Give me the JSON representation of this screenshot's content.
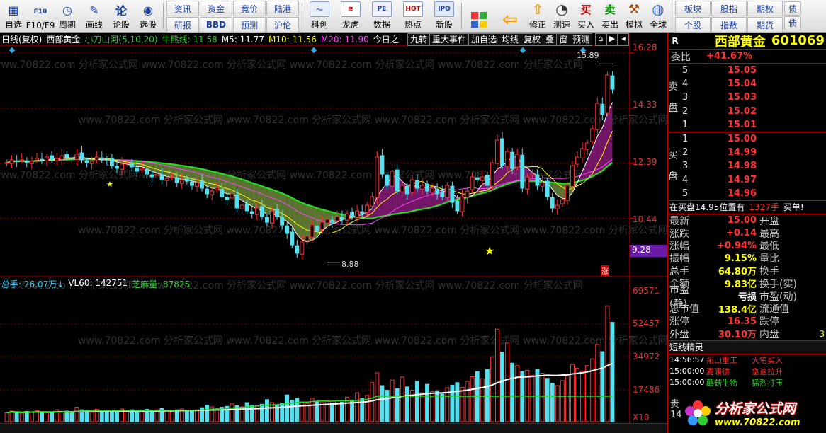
{
  "toolbar": {
    "left_buttons": [
      {
        "label": "自选",
        "icon": "grid-icon"
      },
      {
        "label": "F10/F9",
        "icon": "f10-icon"
      },
      {
        "label": "周期",
        "icon": "clock-icon"
      },
      {
        "label": "画线",
        "icon": "pencil-icon"
      },
      {
        "label": "论股",
        "icon": "discuss-icon"
      },
      {
        "label": "选股",
        "icon": "chart-pick-icon"
      }
    ],
    "grid1": [
      "资讯",
      "资金",
      "竞价",
      "陆港",
      "研报",
      "BBD",
      "预测",
      "沪伦"
    ],
    "icon_buttons": [
      {
        "label": "科创",
        "icon": "kechuang-icon"
      },
      {
        "label": "龙虎",
        "icon": "dragon-icon"
      },
      {
        "label": "数据",
        "icon": "pe-icon"
      },
      {
        "label": "热点",
        "icon": "hot-icon"
      },
      {
        "label": "新股",
        "icon": "ipo-icon"
      }
    ],
    "right_buttons": [
      {
        "label": "",
        "icon": "window-layout-icon"
      },
      {
        "label": "",
        "icon": "back-arrow-icon"
      },
      {
        "label": "修正",
        "icon": "correct-icon"
      },
      {
        "label": "测速",
        "icon": "speed-icon"
      },
      {
        "label": "买入",
        "icon": "buy-icon"
      },
      {
        "label": "卖出",
        "icon": "sell-icon"
      },
      {
        "label": "模拟",
        "icon": "hammer-icon"
      },
      {
        "label": "全球",
        "icon": "globe-icon"
      }
    ],
    "grid2": [
      "板块",
      "股指",
      "期权",
      "个股",
      "指数",
      "期货"
    ],
    "grid2_extra": [
      "债",
      "债"
    ]
  },
  "chart_header": {
    "period": "日线(复权)",
    "stock": "西部黄金",
    "indicator": "小刀山河(5,10,20)",
    "bull_label": "牛熊线:",
    "bull_value": "11.58",
    "m5_label": "M5:",
    "m5_value": "11.77",
    "m10_label": "M10:",
    "m10_value": "11.56",
    "m20_label": "M20:",
    "m20_value": "11.90",
    "today": "今日之",
    "tabs": [
      "九转",
      "重大事件",
      "加自选",
      "均线",
      "复权",
      "叠",
      "窗",
      "预测"
    ]
  },
  "price_axis": [
    "16.28",
    "14.33",
    "12.39",
    "10.44",
    "9.28"
  ],
  "price_annotations": {
    "high": "15.89",
    "low": "8.88",
    "zhang": "涨"
  },
  "volume_header": {
    "total_label": "总手:",
    "total_value": "26.07万",
    "vl60_label": "VL60:",
    "vl60_value": "142751",
    "zhima_label": "芝麻量:",
    "zhima_value": "87825"
  },
  "volume_axis": [
    "69571",
    "52457",
    "34972",
    "17486",
    "X10"
  ],
  "watermark": "www.70822.com 分析家公式网",
  "panel": {
    "r": "R",
    "name": "西部黄金",
    "code": "601069",
    "weibi_label": "委比",
    "weibi_value": "+41.67%",
    "sell_side": "卖盘",
    "buy_side": "买盘",
    "sell": [
      {
        "level": "5",
        "price": "15.05"
      },
      {
        "level": "4",
        "price": "15.04"
      },
      {
        "level": "3",
        "price": "15.03"
      },
      {
        "level": "2",
        "price": "15.02"
      },
      {
        "level": "1",
        "price": "15.01"
      }
    ],
    "buy": [
      {
        "level": "1",
        "price": "15.00"
      },
      {
        "level": "2",
        "price": "14.99"
      },
      {
        "level": "3",
        "price": "14.98"
      },
      {
        "level": "4",
        "price": "14.97"
      },
      {
        "level": "5",
        "price": "14.96"
      }
    ],
    "zaimai_text": "在买盘14.95位置有",
    "zaimai_vol": "1327手",
    "zaimai_tail": "买单!",
    "stats": [
      {
        "k": "最新",
        "v": "15.00",
        "c": "red",
        "k2": "开盘"
      },
      {
        "k": "涨跌",
        "v": "+0.14",
        "c": "red",
        "k2": "最高"
      },
      {
        "k": "涨幅",
        "v": "+0.94%",
        "c": "red",
        "k2": "最低"
      },
      {
        "k": "振幅",
        "v": "9.15%",
        "c": "yellow",
        "k2": "量比"
      },
      {
        "k": "总手",
        "v": "64.80万",
        "c": "yellow",
        "k2": "换手"
      },
      {
        "k": "金额",
        "v": "9.83亿",
        "c": "yellow",
        "k2": "换手(实)"
      },
      {
        "k": "市盈(静)",
        "v": "亏损",
        "c": "white",
        "k2": "市盈(动)"
      },
      {
        "k": "总市值",
        "v": "138.4亿",
        "c": "yellow",
        "k2": "流通值"
      },
      {
        "k": "涨停",
        "v": "16.35",
        "c": "red",
        "k2": "跌停"
      },
      {
        "k": "外盘",
        "v": "30.10万",
        "c": "red",
        "k2": "内盘"
      }
    ],
    "last_stat_extra": "3",
    "dx_title": "短线精灵",
    "dx": [
      {
        "t": "14:56:57",
        "n": "拓山重工",
        "e": "大笔买入",
        "nc": "red",
        "ec": "red"
      },
      {
        "t": "15:00:00",
        "n": "麦澜德",
        "e": "急速拉升",
        "nc": "red",
        "ec": "red"
      },
      {
        "t": "15:00:00",
        "n": "蘑菇生物",
        "e": "猛烈打压",
        "nc": "green",
        "ec": "green"
      }
    ],
    "corner": "贵",
    "corner2": "14"
  },
  "logo": {
    "line1": "分析家公式网",
    "line2": "www.70822.com"
  },
  "colors": {
    "up": "#ff3333",
    "down": "#55e0f0",
    "bull": "#22dd22",
    "ma5": "#ffffff",
    "ma10": "#ffff00",
    "ma20": "#ff44ff",
    "cloud_green": "#6b8a3a",
    "cloud_purple": "#8a1a7a"
  },
  "chart_data": {
    "type": "candlestick",
    "ylim": [
      8.5,
      16.5
    ],
    "closes": [
      12.4,
      12.5,
      12.45,
      12.5,
      12.4,
      12.45,
      12.55,
      12.5,
      12.6,
      12.5,
      12.55,
      12.65,
      12.6,
      12.55,
      12.7,
      12.5,
      12.4,
      12.45,
      12.6,
      12.55,
      12.5,
      12.3,
      12.2,
      12.35,
      12.4,
      12.25,
      12.1,
      12.2,
      12.0,
      11.9,
      12.0,
      11.8,
      11.85,
      11.9,
      11.7,
      11.8,
      11.75,
      11.6,
      11.7,
      11.5,
      11.3,
      11.4,
      11.5,
      11.2,
      11.1,
      11.3,
      10.8,
      10.9,
      10.7,
      10.6,
      10.8,
      10.5,
      10.3,
      10.7,
      10.5,
      10.2,
      9.9,
      9.5,
      9.2,
      9.6,
      9.8,
      10.2,
      10.0,
      10.3,
      10.4,
      10.3,
      10.5,
      10.4,
      10.6,
      10.5,
      10.7,
      10.6,
      10.9,
      11.2,
      12.6,
      12.0,
      11.6,
      12.1,
      11.4,
      11.6,
      11.3,
      11.8,
      11.5,
      11.6,
      11.4,
      11.5,
      11.3,
      11.2,
      11.6,
      11.0,
      10.7,
      11.2,
      11.4,
      11.9,
      11.8,
      11.9,
      11.6,
      12.4,
      13.2,
      12.3,
      12.8,
      12.2,
      12.7,
      11.5,
      11.9,
      12.0,
      11.6,
      11.7,
      11.2,
      10.8,
      10.9,
      11.1,
      11.6,
      12.3,
      12.6,
      12.9,
      13.1,
      13.6,
      14.5,
      14.1,
      15.5,
      15.0
    ],
    "volumes": [
      2.1,
      2.5,
      2.2,
      2.0,
      2.4,
      2.3,
      2.6,
      2.2,
      2.1,
      2.3,
      2.8,
      2.4,
      2.5,
      2.3,
      3.4,
      2.8,
      2.6,
      2.2,
      2.9,
      2.5,
      2.7,
      2.6,
      2.3,
      3.0,
      2.5,
      2.8,
      2.4,
      2.6,
      2.9,
      2.3,
      2.8,
      3.1,
      2.6,
      2.4,
      2.8,
      3.0,
      2.7,
      2.5,
      2.8,
      3.3,
      3.9,
      3.5,
      3.1,
      3.4,
      3.6,
      4.2,
      3.8,
      3.5,
      4.5,
      3.9,
      3.7,
      4.1,
      5.2,
      4.5,
      3.8,
      4.3,
      6.3,
      5.1,
      5.5,
      4.6,
      4.3,
      5.5,
      4.8,
      4.5,
      4.9,
      4.4,
      5.0,
      4.6,
      5.8,
      5.1,
      6.8,
      5.5,
      6.2,
      9.2,
      11.5,
      8.5,
      7.4,
      9.8,
      7.8,
      10.5,
      8.2,
      7.4,
      9.5,
      6.8,
      8.8,
      7.1,
      7.3,
      6.5,
      8.0,
      8.6,
      9.2,
      8.1,
      9.5,
      10.6,
      11.8,
      10.1,
      12.3,
      15.3,
      21.8,
      16.4,
      18.5,
      13.8,
      13.2,
      11.8,
      12.1,
      10.9,
      12.3,
      11.4,
      10.2,
      9.1,
      8.5,
      9.7,
      10.8,
      13.5,
      12.6,
      11.9,
      13.2,
      14.8,
      18.2,
      16.5,
      27.3,
      23.4
    ]
  }
}
